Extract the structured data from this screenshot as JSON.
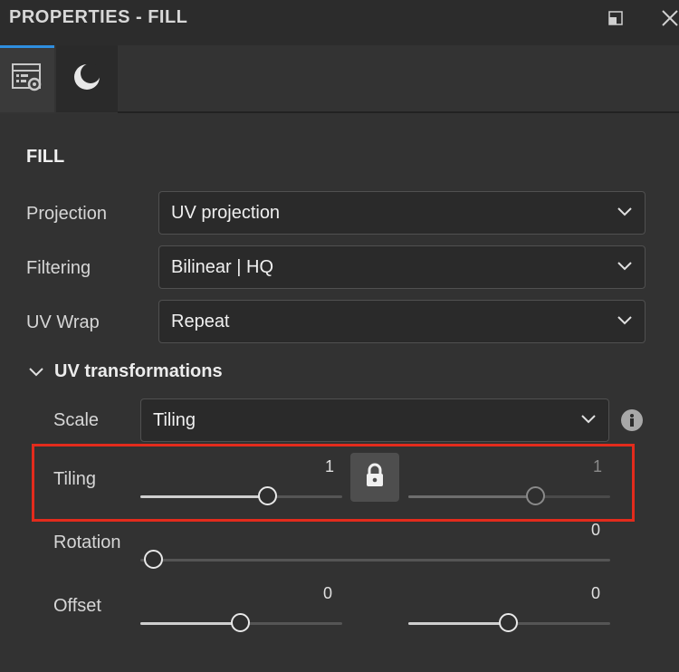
{
  "window": {
    "title": "PROPERTIES - FILL"
  },
  "tabs": [
    {
      "icon": "properties-settings-icon"
    },
    {
      "icon": "material-moon-icon"
    }
  ],
  "section": {
    "title": "FILL"
  },
  "fields": {
    "projection": {
      "label": "Projection",
      "value": "UV projection"
    },
    "filtering": {
      "label": "Filtering",
      "value": "Bilinear | HQ"
    },
    "uv_wrap": {
      "label": "UV Wrap",
      "value": "Repeat"
    }
  },
  "uv_transformations": {
    "title": "UV transformations",
    "scale": {
      "label": "Scale",
      "value": "Tiling"
    },
    "tiling": {
      "label": "Tiling",
      "value_1": "1",
      "value_2": "1",
      "level_1": 0.6,
      "level_2": 0.6
    },
    "rotation": {
      "label": "Rotation",
      "value": "0",
      "level": 0.0
    },
    "offset": {
      "label": "Offset",
      "value_1": "0",
      "value_2": "0",
      "level_1": 0.5,
      "level_2": 0.5
    }
  },
  "colors": {
    "accent": "#2f8fe0",
    "highlight": "#e32b1c"
  }
}
